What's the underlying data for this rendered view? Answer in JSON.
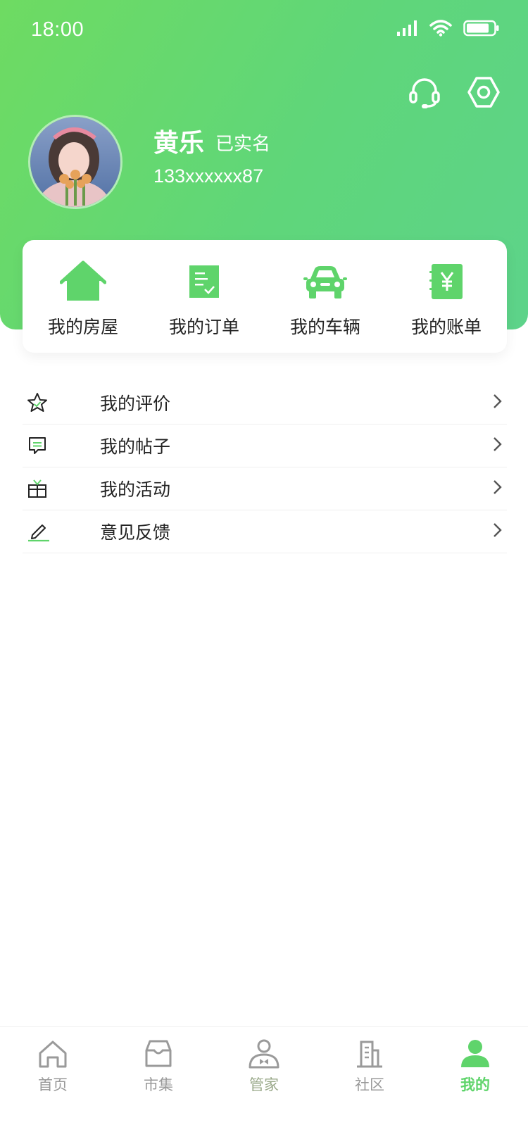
{
  "status_bar": {
    "time": "18:00"
  },
  "user": {
    "name": "黄乐",
    "verified": "已实名",
    "phone": "133xxxxxx87"
  },
  "top_actions": {
    "support_icon": "headset-icon",
    "settings_icon": "hexagon-settings-icon"
  },
  "quick_actions": [
    {
      "label": "我的房屋",
      "icon": "house-icon"
    },
    {
      "label": "我的订单",
      "icon": "order-checklist-icon"
    },
    {
      "label": "我的车辆",
      "icon": "car-icon"
    },
    {
      "label": "我的账单",
      "icon": "bill-yen-icon"
    }
  ],
  "menu": [
    {
      "label": "我的评价",
      "icon": "star-icon"
    },
    {
      "label": "我的帖子",
      "icon": "chat-bubble-icon"
    },
    {
      "label": "我的活动",
      "icon": "gift-icon"
    },
    {
      "label": "意见反馈",
      "icon": "pencil-icon"
    }
  ],
  "tabs": [
    {
      "label": "首页",
      "icon": "home-icon"
    },
    {
      "label": "市集",
      "icon": "market-box-icon"
    },
    {
      "label": "管家",
      "icon": "butler-icon"
    },
    {
      "label": "社区",
      "icon": "building-icon"
    },
    {
      "label": "我的",
      "icon": "person-icon"
    }
  ],
  "colors": {
    "primary": "#5fd46b",
    "header_start": "#6edb62",
    "header_end": "#5dd38a"
  }
}
